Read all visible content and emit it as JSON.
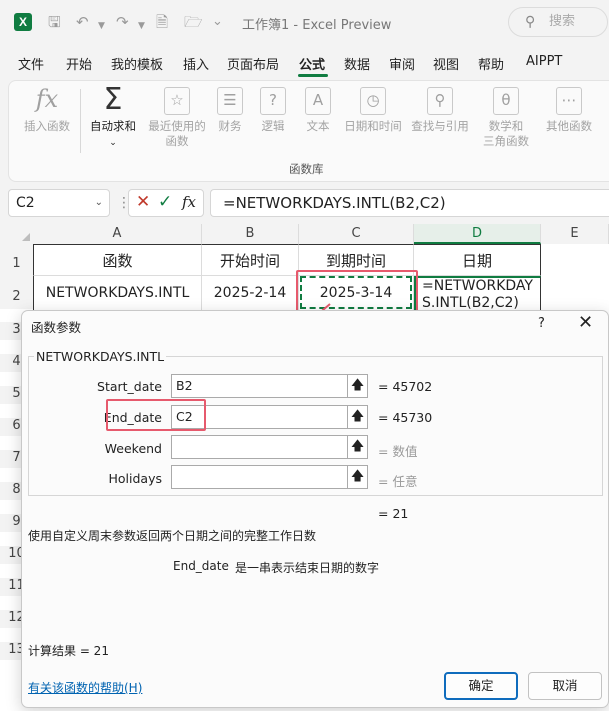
{
  "titlebar": {
    "app_letter": "X",
    "title": "工作簿1  -  Excel Preview",
    "search_placeholder": "搜索"
  },
  "menu": [
    "文件",
    "开始",
    "我的模板",
    "插入",
    "页面布局",
    "公式",
    "数据",
    "审阅",
    "视图",
    "帮助",
    "AIPPT"
  ],
  "ribbon": {
    "insert_function": "插入函数",
    "autosum": "自动求和",
    "recent_1": "最近使用的",
    "recent_2": "函数",
    "financial": "财务",
    "logical": "逻辑",
    "text": "文本",
    "datetime": "日期和时间",
    "lookup": "查找与引用",
    "math_1": "数学和",
    "math_2": "三角函数",
    "more": "其他函数",
    "group_label": "函数库"
  },
  "formula_bar": {
    "name_box": "C2",
    "formula": "=NETWORKDAYS.INTL(B2,C2)"
  },
  "sheet": {
    "columns": [
      "A",
      "B",
      "C",
      "D",
      "E"
    ],
    "rows": [
      "1",
      "2",
      "3",
      "4",
      "5",
      "6",
      "7",
      "8",
      "9",
      "10",
      "11",
      "12",
      "13"
    ],
    "header_row": [
      "函数",
      "开始时间",
      "到期时间",
      "日期"
    ],
    "data_row": [
      "NETWORKDAYS.INTL",
      "2025-2-14",
      "2025-3-14",
      "=NETWORKDAYS.INTL(B2,C2)"
    ]
  },
  "dialog": {
    "title": "函数参数",
    "help_icon": "?",
    "function_name": "NETWORKDAYS.INTL",
    "args": [
      {
        "label": "Start_date",
        "value": "B2",
        "result": "=  45702"
      },
      {
        "label": "End_date",
        "value": "C2",
        "result": "=  45730"
      },
      {
        "label": "Weekend",
        "value": "",
        "result": "=  数值"
      },
      {
        "label": "Holidays",
        "value": "",
        "result": "=  任意"
      }
    ],
    "overall_result": "=  21",
    "description": "使用自定义周末参数返回两个日期之间的完整工作日数",
    "arg_help_name": "End_date",
    "arg_help_text": "是一串表示结束日期的数字",
    "calc_result": "计算结果 =   21",
    "help_link": "有关该函数的帮助(H)",
    "ok": "确定",
    "cancel": "取消"
  },
  "colors": {
    "accent": "#107c41",
    "highlight": "#e65a6d",
    "link": "#0063b1",
    "primary_border": "#0f6cbd"
  }
}
